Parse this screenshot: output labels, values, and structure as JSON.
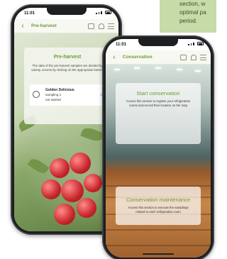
{
  "corner_text": [
    "section, w",
    "optimal pa",
    "period."
  ],
  "back_phone": {
    "status_time": "11:01",
    "appbar_title": "Pre-harvest",
    "card_title": "Pre-harvest",
    "card_description": "The data of the pre-harvest samples are divided by variety, access by clicking on the appropriate button!",
    "variety": {
      "name": "Golden Delicious",
      "sampling": "sampling 1",
      "state": "not started"
    }
  },
  "front_phone": {
    "status_time": "11:01",
    "appbar_title": "Conservation",
    "start_card": {
      "title": "Start conservation",
      "description": "Access this section to register your refrigeration rooms and record their location on the map"
    },
    "maint_card": {
      "title": "Conservation maintenance",
      "description": "Access this section to execute the samplings related to each refrigeration room"
    }
  },
  "colors": {
    "accent": "#6f9b35",
    "corner_card": "#c6dba8"
  },
  "icons": [
    "back-arrow-icon",
    "message-icon",
    "bell-icon",
    "menu-icon",
    "apple-icon",
    "chevron-right-icon"
  ]
}
